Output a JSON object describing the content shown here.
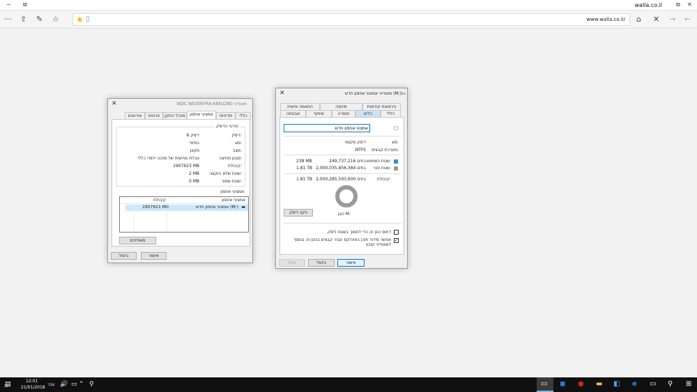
{
  "browser": {
    "tab_title": "walla.co.il",
    "url": "www.walla.co.il/",
    "title_controls": [
      "□",
      "⧉",
      "─",
      "✕"
    ]
  },
  "disk_dialog": {
    "title": "WDC WD30EFRX-68EUZN0 מאפייני",
    "tabs": [
      "כללי",
      "מדיניות",
      "אמצעי אחסון",
      "מנהל התקן",
      "פרטים",
      "אירועים"
    ],
    "section_title": "פרטי הדיסק:",
    "rows": [
      {
        "label": "דיסק:",
        "value": "דיסק 6"
      },
      {
        "label": "סוג:",
        "value": "בסיסי"
      },
      {
        "label": "מצב:",
        "value": "מקוון"
      },
      {
        "label": "סגנון מחיצה:",
        "value": "טבלת מחיצות של מזהה ייחודי כללי"
      },
      {
        "label": "קיבולת:",
        "value": "1907623 MB"
      },
      {
        "label": "שטח שלא הוקצה:",
        "value": "2 MB"
      },
      {
        "label": "שטח שמור:",
        "value": "0 MB"
      }
    ],
    "volumes_title": "אמצעי אחסון:",
    "volumes_headers": [
      "אמצעי אחסון",
      "קיבולת"
    ],
    "volumes": [
      {
        "name": "אמצעי אחסון חדש (M:)",
        "capacity": "1907621 MB"
      }
    ],
    "properties_button": "מאפיינים",
    "ok": "אישור",
    "cancel": "ביטול"
  },
  "vol_dialog": {
    "title": "מאפייני אמצעי אחסון חדש (M:)",
    "tabs_row1": [
      "גירסאות קודמות",
      "מיכסה",
      "התאמה אישית"
    ],
    "tabs_row2": [
      "כללי",
      "כלים",
      "חומרה",
      "שיתוף",
      "אבטחה"
    ],
    "name_value": "אמצעי אחסון חדש",
    "type_label": "סוג:",
    "type_value": "דיסק מקומי",
    "fs_label": "מערכת קבצים:",
    "fs_value": "NTFS",
    "used_label": "שטח בשימוש:",
    "used_bytes": "249,737,216 בתים",
    "used_size": "238 MB",
    "free_label": "שטח פנוי:",
    "free_bytes": "2,000,035,856,384 בתים",
    "free_size": "1.81 TB",
    "cap_label": "קיבולת:",
    "cap_bytes": "2,000,285,593,600 בתים",
    "cap_size": "1.81 TB",
    "drive_label": "כונן M:",
    "cleanup_button": "ניקוי דיסק",
    "compress_label": "דחוס כונן זה כדי לחסוך בשטח דיסק",
    "index_label": "אפשר סידור תוכן באינדקס עבור קבצים בכונן זה בנוסף למאפייני קובץ",
    "compress_checked": false,
    "index_checked": true,
    "ok": "אישור",
    "cancel": "ביטול",
    "apply": "החל",
    "colors": {
      "used": "#2f8fd8",
      "free": "#9a9a9a"
    },
    "used_fraction": 0.0001
  },
  "taskbar": {
    "time": "12:01",
    "date": "21/01/2018",
    "lang": "עבר",
    "notif_count": "25"
  }
}
